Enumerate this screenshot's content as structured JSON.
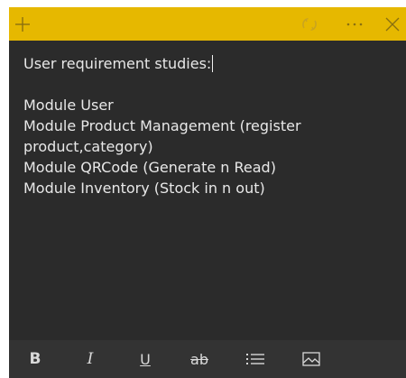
{
  "colors": {
    "titlebar": "#e6b800",
    "titlebar_icons": "#8a7010",
    "note_background": "#2b2b2b",
    "format_bar": "#333333",
    "text": "#e8e8e8"
  },
  "titlebar": {
    "add_icon": "plus-icon",
    "sync_icon": "sync-icon",
    "more_icon": "ellipsis-icon",
    "close_icon": "close-icon"
  },
  "note": {
    "title": "User requirement studies:",
    "lines": [
      "Module User",
      "Module Product Management (register product,category)",
      "Module QRCode (Generate n Read)",
      "Module Inventory (Stock in n out)"
    ]
  },
  "format_bar": {
    "bold_label": "B",
    "italic_label": "I",
    "underline_label": "U",
    "strikethrough_label": "ab",
    "list_icon": "bullet-list-icon",
    "image_icon": "image-icon"
  }
}
